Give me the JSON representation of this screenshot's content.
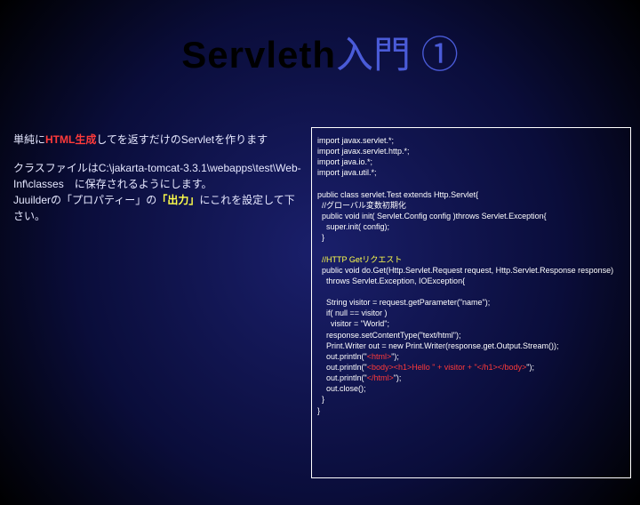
{
  "title": {
    "word1": "Servleth",
    "word2": "入門 ①"
  },
  "left": {
    "p1_a": "単純に",
    "p1_hl": "HTML生成",
    "p1_b": "してを返すだけのServletを作ります",
    "p2_a": "クラスファイルはC:\\jakarta-tomcat-3.3.1\\webapps\\test\\Web-Inf\\classes　に保存されるようにします。",
    "p2_b": "Juuilderの「プロパティー」の",
    "p2_hl": "「出力」",
    "p2_c": "にこれを設定して下さい。"
  },
  "code": {
    "l1": "import javax.servlet.*;",
    "l2": "import javax.servlet.http.*;",
    "l3": "import java.io.*;",
    "l4": "import java.util.*;",
    "l5": "",
    "l6": "public class servlet.Test extends Http.Servlet{",
    "l7": "  //グローバル変数初期化",
    "l8": "  public void init( Servlet.Config config )throws Servlet.Exception{",
    "l9": "    super.init( config);",
    "l10": "  }",
    "l11": "",
    "l12": "  //HTTP Getリクエスト",
    "l13": "  public void do.Get(Http.Servlet.Request request, Http.Servlet.Response response)",
    "l14": "    throws Servlet.Exception, IOException{",
    "l15": "",
    "l16": "    String visitor = request.getParameter(\"name\");",
    "l17": "    if( null == visitor )",
    "l18": "      visitor = \"World\";",
    "l19": "    response.setContentType(\"text/html\");",
    "l20": "    Print.Writer out = new Print.Writer(response.get.Output.Stream());",
    "l21a": "    out.println(\"",
    "l21b": "<html>",
    "l21c": "\");",
    "l22a": "    out.println(\"",
    "l22b": "<body><h1>Hello \" + visitor + \"</h1></body>",
    "l22c": "\");",
    "l23a": "    out.println(\"",
    "l23b": "</html>",
    "l23c": "\");",
    "l24": "    out.close();",
    "l25": "  }",
    "l26": "}"
  }
}
